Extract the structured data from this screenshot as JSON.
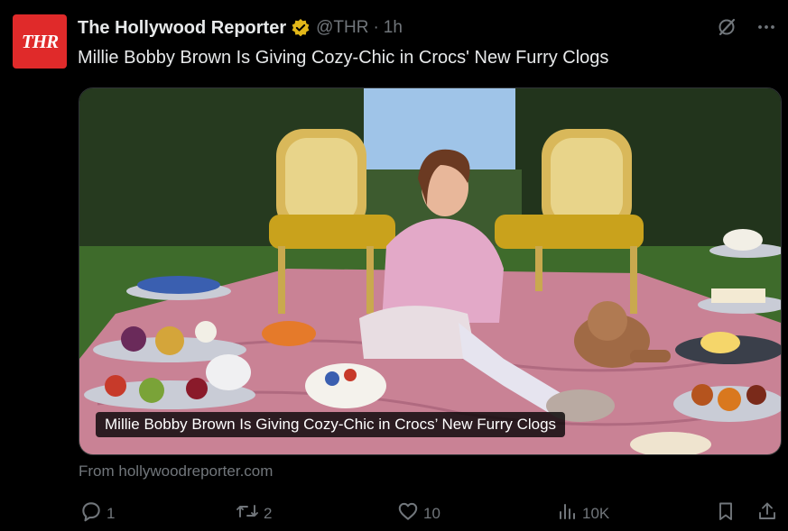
{
  "author": {
    "avatar_text": "THR",
    "name": "The Hollywood Reporter",
    "handle": "@THR",
    "separator": "·",
    "time": "1h",
    "verified_color": "#e2b719"
  },
  "tweet": {
    "text": "Millie Bobby Brown Is Giving Cozy-Chic in Crocs' New Furry Clogs"
  },
  "card": {
    "caption": "Millie Bobby Brown Is Giving Cozy-Chic in Crocs’ New Furry Clogs",
    "source": "From hollywoodreporter.com"
  },
  "actions": {
    "replies": "1",
    "reposts": "2",
    "likes": "10",
    "views": "10K"
  },
  "icons": [
    "verified-badge-icon",
    "grok-icon",
    "more-icon",
    "reply-icon",
    "repost-icon",
    "like-icon",
    "views-icon",
    "bookmark-icon",
    "share-icon"
  ],
  "colors": {
    "background": "#000000",
    "text": "#e7e9ea",
    "muted": "#71767b",
    "thr_red": "#e02a2a"
  }
}
